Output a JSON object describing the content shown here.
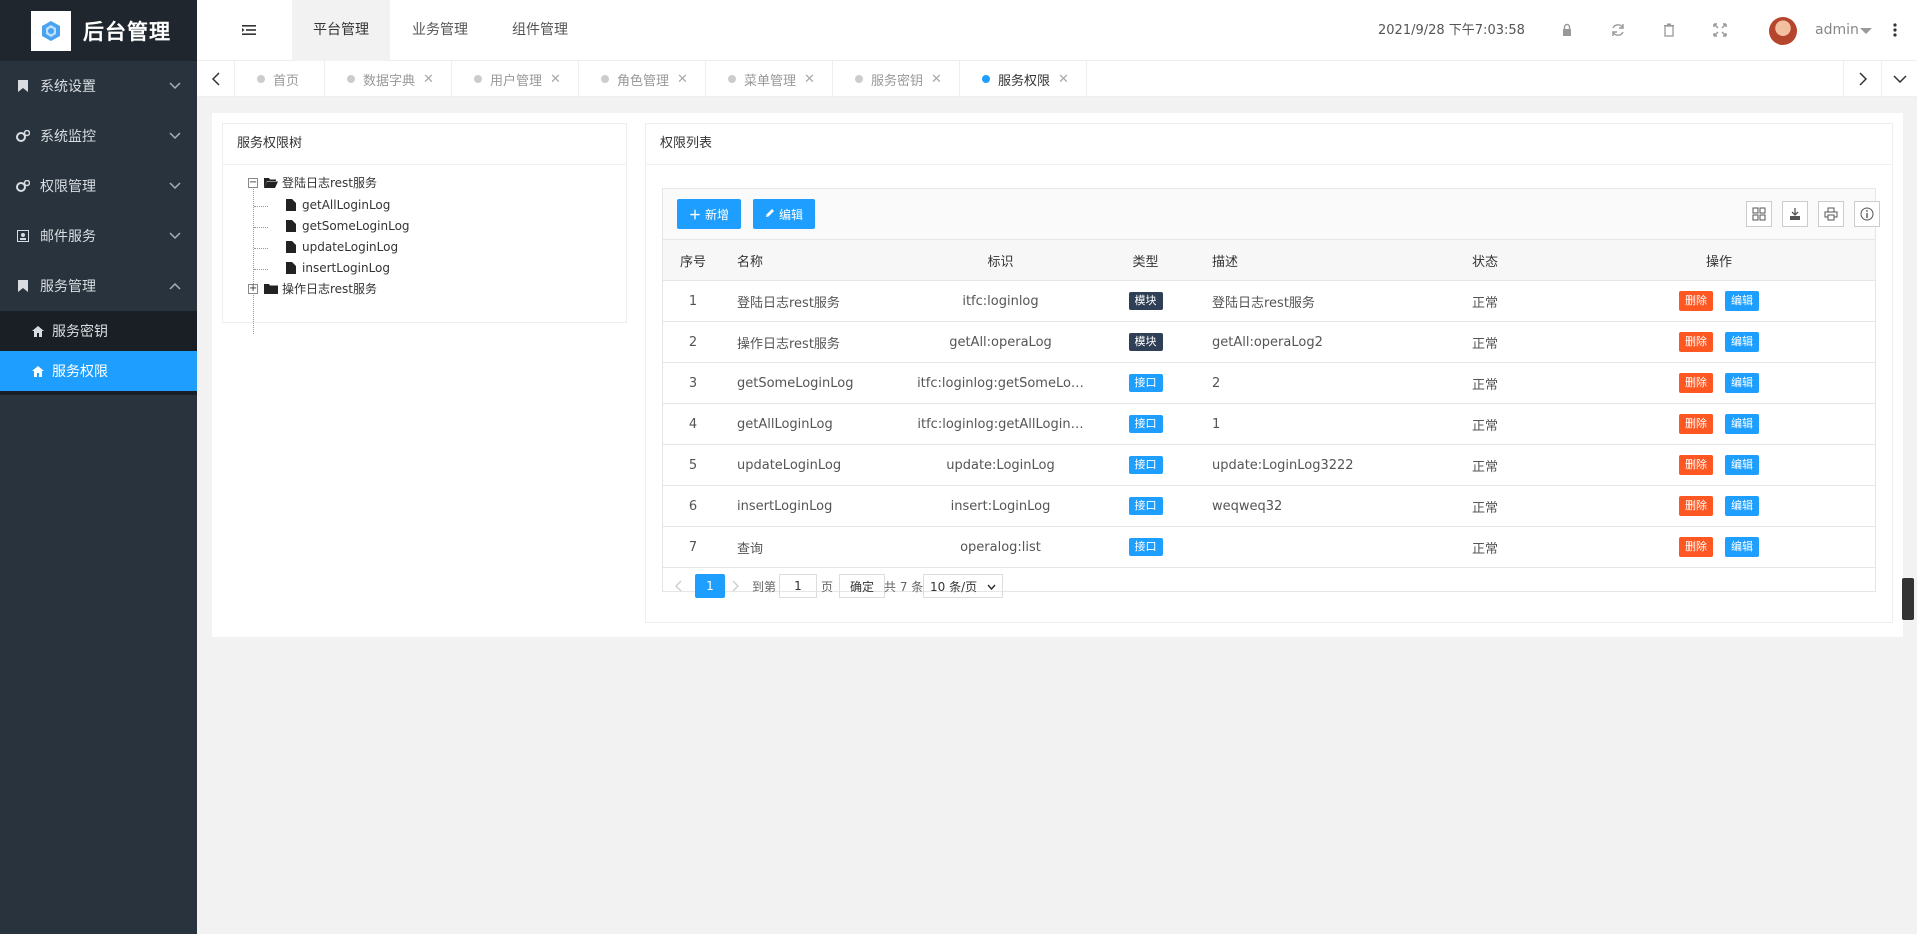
{
  "app": {
    "title": "后台管理"
  },
  "sidebar": {
    "groups": [
      {
        "label": "系统设置",
        "icon": "bookmark-icon"
      },
      {
        "label": "系统监控",
        "icon": "gears-icon"
      },
      {
        "label": "权限管理",
        "icon": "gears-icon"
      },
      {
        "label": "邮件服务",
        "icon": "contact-card-icon"
      },
      {
        "label": "服务管理",
        "icon": "bookmark-icon",
        "expanded": true
      }
    ],
    "sub_items": [
      {
        "label": "服务密钥",
        "icon": "home-icon"
      },
      {
        "label": "服务权限",
        "icon": "home-icon",
        "active": true
      }
    ]
  },
  "header": {
    "tabs": [
      "平台管理",
      "业务管理",
      "组件管理"
    ],
    "datetime": "2021/9/28 下午7:03:58",
    "username": "admin"
  },
  "page_tabs": [
    {
      "label": "首页",
      "closable": false
    },
    {
      "label": "数据字典",
      "closable": true
    },
    {
      "label": "用户管理",
      "closable": true
    },
    {
      "label": "角色管理",
      "closable": true
    },
    {
      "label": "菜单管理",
      "closable": true
    },
    {
      "label": "服务密钥",
      "closable": true
    },
    {
      "label": "服务权限",
      "closable": true,
      "active": true
    }
  ],
  "tree": {
    "title": "服务权限树",
    "nodes": [
      {
        "label": "登陆日志rest服务",
        "expanded": true,
        "children": [
          "getAllLoginLog",
          "getSomeLoginLog",
          "updateLoginLog",
          "insertLoginLog"
        ]
      },
      {
        "label": "操作日志rest服务",
        "expanded": false
      }
    ]
  },
  "list": {
    "title": "权限列表",
    "add_label": "新增",
    "edit_label": "编辑",
    "columns": [
      "序号",
      "名称",
      "标识",
      "类型",
      "描述",
      "状态",
      "操作"
    ],
    "rows": [
      {
        "no": "1",
        "name": "登陆日志rest服务",
        "key": "itfc:loginlog",
        "type": "模块",
        "type_kind": "module",
        "desc": "登陆日志rest服务",
        "status": "正常"
      },
      {
        "no": "2",
        "name": "操作日志rest服务",
        "key": "getAll:operaLog",
        "type": "模块",
        "type_kind": "module",
        "desc": "getAll:operaLog2",
        "status": "正常"
      },
      {
        "no": "3",
        "name": "getSomeLoginLog",
        "key": "itfc:loginlog:getSomeLo…",
        "type": "接口",
        "type_kind": "api",
        "desc": "2",
        "status": "正常"
      },
      {
        "no": "4",
        "name": "getAllLoginLog",
        "key": "itfc:loginlog:getAllLogin…",
        "type": "接口",
        "type_kind": "api",
        "desc": "1",
        "status": "正常"
      },
      {
        "no": "5",
        "name": "updateLoginLog",
        "key": "update:LoginLog",
        "type": "接口",
        "type_kind": "api",
        "desc": "update:LoginLog3222",
        "status": "正常"
      },
      {
        "no": "6",
        "name": "insertLoginLog",
        "key": "insert:LoginLog",
        "type": "接口",
        "type_kind": "api",
        "desc": "weqweq32",
        "status": "正常"
      },
      {
        "no": "7",
        "name": "查询",
        "key": "operalog:list",
        "type": "接口",
        "type_kind": "api",
        "desc": "",
        "status": "正常"
      }
    ],
    "row_delete_label": "删除",
    "row_edit_label": "编辑"
  },
  "pager": {
    "current": "1",
    "goto_label": "到第",
    "goto_value": "1",
    "page_label": "页",
    "confirm_label": "确定",
    "total_label": "共 7 条",
    "page_size": "10 条/页"
  },
  "colors": {
    "accent": "#1e9fff",
    "danger": "#ff5722",
    "sidebar": "#28333e",
    "module_badge": "#2f4056"
  }
}
